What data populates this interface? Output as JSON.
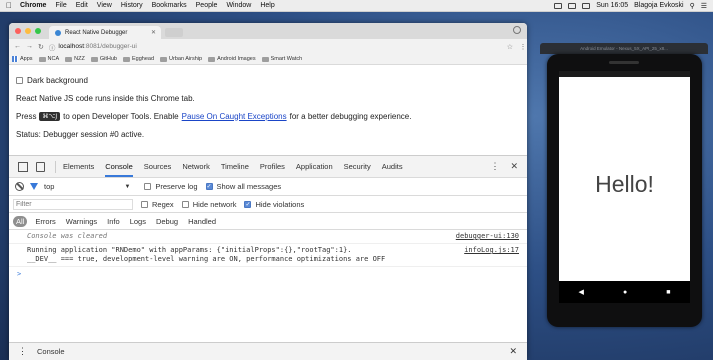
{
  "menubar": {
    "app": "Chrome",
    "items": [
      "File",
      "Edit",
      "View",
      "History",
      "Bookmarks",
      "People",
      "Window",
      "Help"
    ],
    "clock": "Sun 16:05",
    "user": "Blagoja Evkoski"
  },
  "browser": {
    "tab_title": "React Native Debugger",
    "url_host": "localhost",
    "url_path": ":8081/debugger-ui",
    "bookmarks": [
      "Apps",
      "NCA",
      "NZZ",
      "GitHub",
      "Egghead",
      "Urban Airship",
      "Android Images",
      "Smart Watch"
    ]
  },
  "page": {
    "dark_background": "Dark background",
    "line1": "React Native JS code runs inside this Chrome tab.",
    "line2_before": "Press",
    "shortcut": "⌘⌥J",
    "line2_mid": "to open Developer Tools. Enable",
    "line2_link": "Pause On Caught Exceptions",
    "line2_after": "for a better debugging experience.",
    "status": "Status: Debugger session #0 active."
  },
  "devtools": {
    "tabs": [
      "Elements",
      "Console",
      "Sources",
      "Network",
      "Timeline",
      "Profiles",
      "Application",
      "Security",
      "Audits"
    ],
    "active_tab": "Console",
    "context": "top",
    "preserve_log": "Preserve log",
    "show_all": "Show all messages",
    "filter_placeholder": "Filter",
    "regex": "Regex",
    "hide_network": "Hide network",
    "hide_violations": "Hide violations",
    "levels": [
      "All",
      "Errors",
      "Warnings",
      "Info",
      "Logs",
      "Debug",
      "Handled"
    ],
    "log": [
      {
        "msg": "Console was cleared",
        "src": "debugger-ui:130"
      },
      {
        "msg": "Running application \"RNDemo\" with appParams: {\"initialProps\":{},\"rootTag\":1}.\n__DEV__ === true, development-level warning are ON, performance optimizations are OFF",
        "src": "infoLog.js:17"
      }
    ],
    "prompt": ">",
    "drawer_tab": "Console"
  },
  "emulator": {
    "title": "Android Emulator - Nexus_5X_API_25_x8...",
    "hello": "Hello!"
  }
}
